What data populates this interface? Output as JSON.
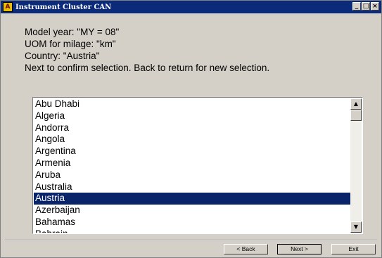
{
  "window": {
    "title": "Instrument Cluster CAN",
    "icon_letter": "A",
    "controls": {
      "minimize": "_",
      "maximize": "□",
      "close": "×"
    }
  },
  "info": {
    "line1": "Model year: \"MY = 08\"",
    "line2": "UOM for milage: \"km\"",
    "line3": "Country: \"Austria\"",
    "line4": "Next to confirm selection. Back to return for new selection."
  },
  "countries": {
    "items": [
      "Abu Dhabi",
      "Algeria",
      "Andorra",
      "Angola",
      "Argentina",
      "Armenia",
      "Aruba",
      "Australia",
      "Austria",
      "Azerbaijan",
      "Bahamas",
      "Bahrain"
    ],
    "selected": "Austria",
    "scroll_up": "▲",
    "scroll_down": "▼"
  },
  "buttons": {
    "back": "< Back",
    "next": "Next >",
    "exit": "Exit"
  },
  "colors": {
    "titlebar": "#0b2a7a",
    "selection": "#0a246a",
    "dialog_bg": "#d4d0c8"
  }
}
